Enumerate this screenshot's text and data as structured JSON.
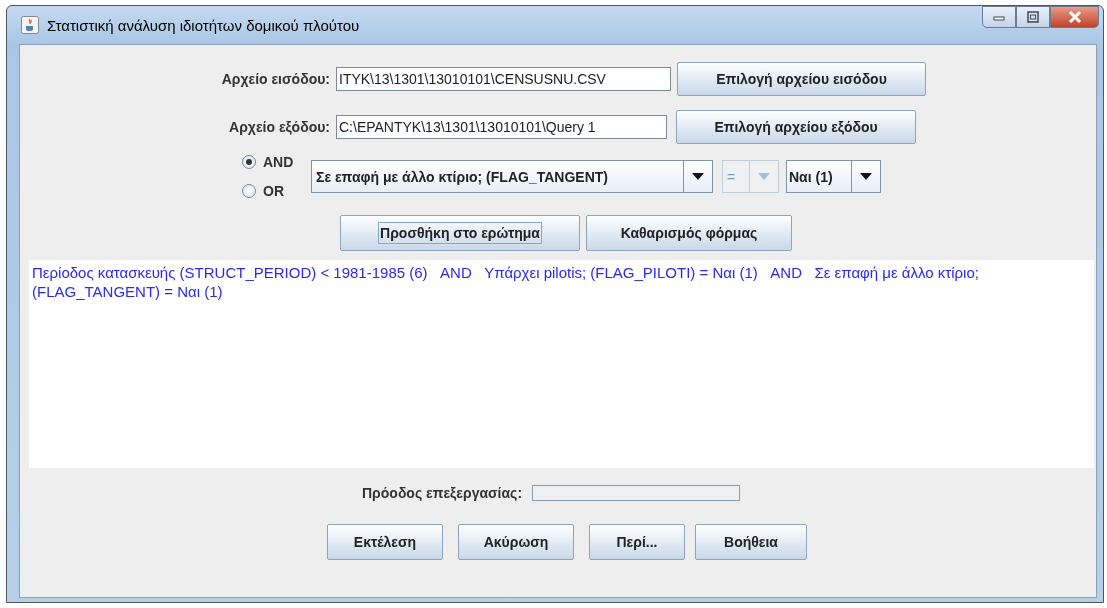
{
  "window": {
    "title": "Στατιστική ανάλυση ιδιοτήτων δομικού πλούτου"
  },
  "input_file": {
    "label": "Αρχείο εισόδου:",
    "value": "ITYK\\13\\1301\\13010101\\CENSUSNU.CSV",
    "button": "Επιλογή αρχείου εισόδου"
  },
  "output_file": {
    "label": "Αρχείο εξόδου:",
    "value": "C:\\EPANTYK\\13\\1301\\13010101\\Query 1",
    "button": "Επιλογή αρχείου εξόδου"
  },
  "logic": [
    {
      "label": "AND",
      "selected": true
    },
    {
      "label": "OR",
      "selected": false
    }
  ],
  "field_combo": {
    "value": "Σε επαφή με άλλο κτίριο; (FLAG_TANGENT)",
    "disabled": false
  },
  "operator_combo": {
    "value": "=",
    "disabled": true
  },
  "value_combo": {
    "value": "Ναι (1)",
    "disabled": false
  },
  "query_buttons": [
    {
      "label": "Προσθήκη στο ερώτημα",
      "focused": true
    },
    {
      "label": "Καθαρισμός φόρμας",
      "focused": false
    }
  ],
  "query_text": "Περίοδος κατασκευής (STRUCT_PERIOD) < 1981-1985 (6)   AND   Υπάρχει pilotis; (FLAG_PILOTI) = Ναι (1)   AND   Σε επαφή με άλλο κτίριο; (FLAG_TANGENT) = Ναι (1)",
  "progress": {
    "label": "Πρόοδος επεξεργασίας:",
    "level": 0
  },
  "buttons": [
    "Εκτέλεση",
    "Ακύρωση",
    "Περί...",
    "Βοήθεια"
  ]
}
